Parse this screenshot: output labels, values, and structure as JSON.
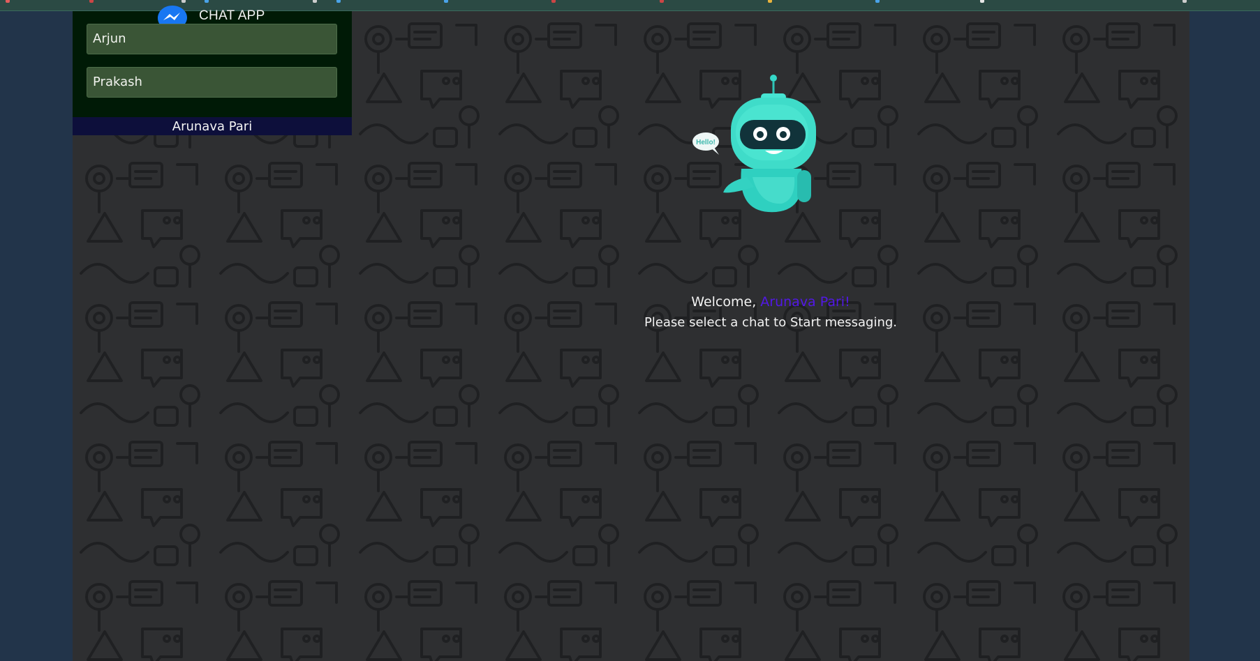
{
  "app": {
    "title": "CHAT APP"
  },
  "sidebar": {
    "contacts": [
      {
        "name": "Arjun"
      },
      {
        "name": "Prakash"
      }
    ],
    "current_user": "Arunava Pari"
  },
  "welcome": {
    "greeting_prefix": "Welcome,",
    "user_name": "Arunava Pari!",
    "instruction": "Please select a chat to Start messaging.",
    "bubble_text": "Hello!"
  },
  "colors": {
    "page_background": "#22344a",
    "chat_background": "#2e2f31",
    "sidebar_background": "#001a06",
    "contact_background": "#3a5536",
    "user_bar_background": "#0d0f3b",
    "welcome_name_accent": "#5218e6",
    "robot_body": "#35d8c8"
  },
  "icons": {
    "brand_logo": "messenger-icon",
    "mascot": "robot-icon"
  }
}
